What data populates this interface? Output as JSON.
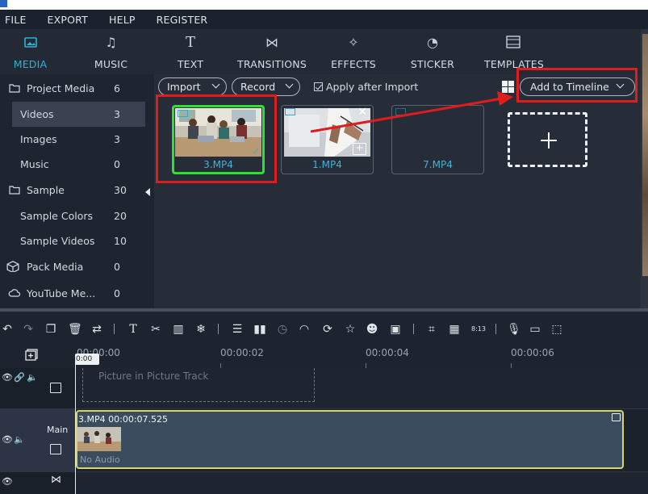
{
  "menu": [
    "FILE",
    "EXPORT",
    "HELP",
    "REGISTER"
  ],
  "tabs": [
    {
      "label": "MEDIA",
      "icon": "media-folder-icon",
      "active": true
    },
    {
      "label": "MUSIC",
      "icon": "music-note-icon"
    },
    {
      "label": "TEXT",
      "icon": "text-t-icon"
    },
    {
      "label": "TRANSITIONS",
      "icon": "transition-bowtie-icon"
    },
    {
      "label": "EFFECTS",
      "icon": "effects-sparkle-icon"
    },
    {
      "label": "STICKER",
      "icon": "sticker-clock-icon"
    },
    {
      "label": "TEMPLATES",
      "icon": "templates-film-icon"
    }
  ],
  "sidebar": {
    "items": [
      {
        "label": "Project Media",
        "count": "6"
      },
      {
        "label": "Videos",
        "count": "3"
      },
      {
        "label": "Images",
        "count": "3"
      },
      {
        "label": "Music",
        "count": "0"
      },
      {
        "label": "Sample",
        "count": "30"
      },
      {
        "label": "Sample Colors",
        "count": "20"
      },
      {
        "label": "Sample Videos",
        "count": "10"
      },
      {
        "label": "Pack Media",
        "count": "0"
      },
      {
        "label": "YouTube Me...",
        "count": "0"
      }
    ]
  },
  "media": {
    "import_label": "Import",
    "record_label": "Record",
    "apply_label": "Apply after Import",
    "add_timeline_label": "Add to Timeline",
    "items": [
      {
        "name": "3.MP4",
        "selected": true
      },
      {
        "name": "1.MP4",
        "selected": false
      },
      {
        "name": "7.MP4",
        "selected": false
      }
    ]
  },
  "timeline": {
    "playhead_label": "0:00",
    "ruler": [
      "00:00:00",
      "00:00:02",
      "00:00:04",
      "00:00:06"
    ],
    "pip_placeholder": "Picture in Picture Track",
    "main_track_label": "Main",
    "clip_title": "3.MP4   00:00:07.525",
    "clip_audio": "No Audio"
  },
  "colors": {
    "accent": "#27b5d8",
    "selected_border": "#2de12d",
    "annotation_red": "#e01c1c",
    "clip_border": "#d9d46a"
  }
}
